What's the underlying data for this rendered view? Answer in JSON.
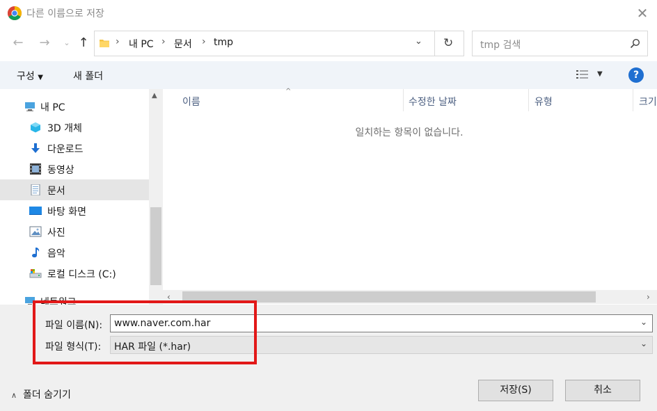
{
  "window": {
    "title": "다른 이름으로 저장"
  },
  "address": {
    "crumbs": [
      "내 PC",
      "문서",
      "tmp"
    ],
    "search_placeholder": "tmp 검색"
  },
  "toolbar": {
    "organize_label": "구성",
    "new_folder_label": "새 폴더"
  },
  "nav": {
    "items": [
      {
        "label": "내 PC",
        "icon": "pc-icon"
      },
      {
        "label": "3D 개체",
        "icon": "3d-objects-icon"
      },
      {
        "label": "다운로드",
        "icon": "downloads-icon"
      },
      {
        "label": "동영상",
        "icon": "videos-icon"
      },
      {
        "label": "문서",
        "icon": "documents-icon",
        "selected": true
      },
      {
        "label": "바탕 화면",
        "icon": "desktop-icon"
      },
      {
        "label": "사진",
        "icon": "pictures-icon"
      },
      {
        "label": "음악",
        "icon": "music-icon"
      },
      {
        "label": "로컬 디스크 (C:)",
        "icon": "local-disk-icon"
      },
      {
        "label": "네트워크",
        "icon": "network-icon"
      }
    ]
  },
  "file_list": {
    "columns": [
      "이름",
      "수정한 날짜",
      "유형",
      "크기"
    ],
    "empty_message": "일치하는 항목이 없습니다."
  },
  "form": {
    "filename_label": "파일 이름(N):",
    "filename_value": "www.naver.com.har",
    "filetype_label": "파일 형식(T):",
    "filetype_value": "HAR 파일 (*.har)"
  },
  "footer": {
    "hide_folders_label": "폴더 숨기기",
    "save_label": "저장(S)",
    "cancel_label": "취소"
  },
  "colors": {
    "highlight_box": "#e21818",
    "selection_bg": "#e5e5e5",
    "help_blue": "#1f6fd1"
  }
}
